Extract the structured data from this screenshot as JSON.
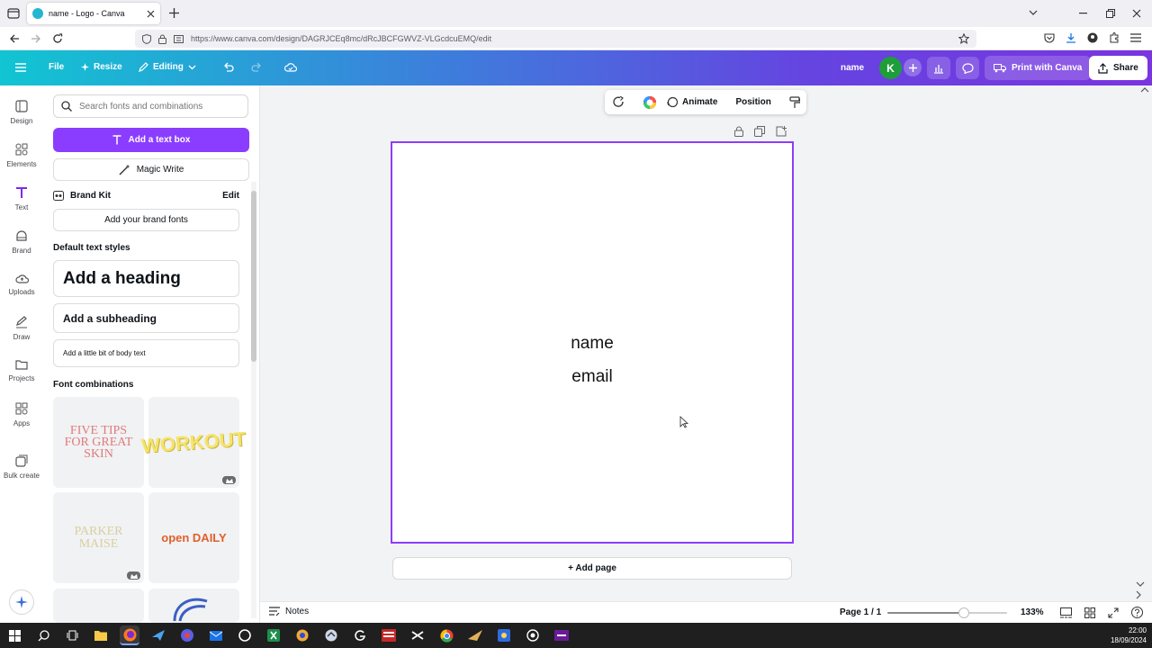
{
  "browser": {
    "tab_title": "name - Logo - Canva",
    "url": "https://www.canva.com/design/DAGRJCEq8mc/dRcJBCFGWVZ-VLGcdcuEMQ/edit"
  },
  "topbar": {
    "file": "File",
    "resize": "Resize",
    "editing": "Editing",
    "design_name": "name",
    "avatar_letter": "K",
    "print": "Print with Canva",
    "share": "Share"
  },
  "rail": [
    {
      "label": "Design",
      "icon": "design-icon"
    },
    {
      "label": "Elements",
      "icon": "elements-icon"
    },
    {
      "label": "Text",
      "icon": "text-icon"
    },
    {
      "label": "Brand",
      "icon": "brand-icon"
    },
    {
      "label": "Uploads",
      "icon": "uploads-icon"
    },
    {
      "label": "Draw",
      "icon": "draw-icon"
    },
    {
      "label": "Projects",
      "icon": "projects-icon"
    },
    {
      "label": "Apps",
      "icon": "apps-icon"
    },
    {
      "label": "Bulk create",
      "icon": "bulk-create-icon"
    }
  ],
  "panel": {
    "search_placeholder": "Search fonts and combinations",
    "add_text_box": "Add a text box",
    "magic_write": "Magic Write",
    "brand_kit": "Brand Kit",
    "edit": "Edit",
    "add_brand_fonts": "Add your brand fonts",
    "default_styles": "Default text styles",
    "heading": "Add a heading",
    "subheading": "Add a subheading",
    "body": "Add a little bit of body text",
    "font_combinations": "Font combinations",
    "thumbs": [
      "FIVE TIPS FOR GREAT SKIN",
      "WORKOUT",
      "PARKER MAISE",
      "open DAILY"
    ]
  },
  "context": {
    "animate": "Animate",
    "position": "Position"
  },
  "canvas": {
    "line1": "name",
    "line2": "email",
    "add_page": "+ Add page"
  },
  "footer": {
    "notes": "Notes",
    "page": "Page 1 / 1",
    "zoom": "133%",
    "zoom_level": 0.64
  },
  "clock": {
    "time": "22:00",
    "date": "18/09/2024"
  },
  "colors": {
    "accent": "#8b3dff",
    "avatar": "#1e9e3a"
  }
}
